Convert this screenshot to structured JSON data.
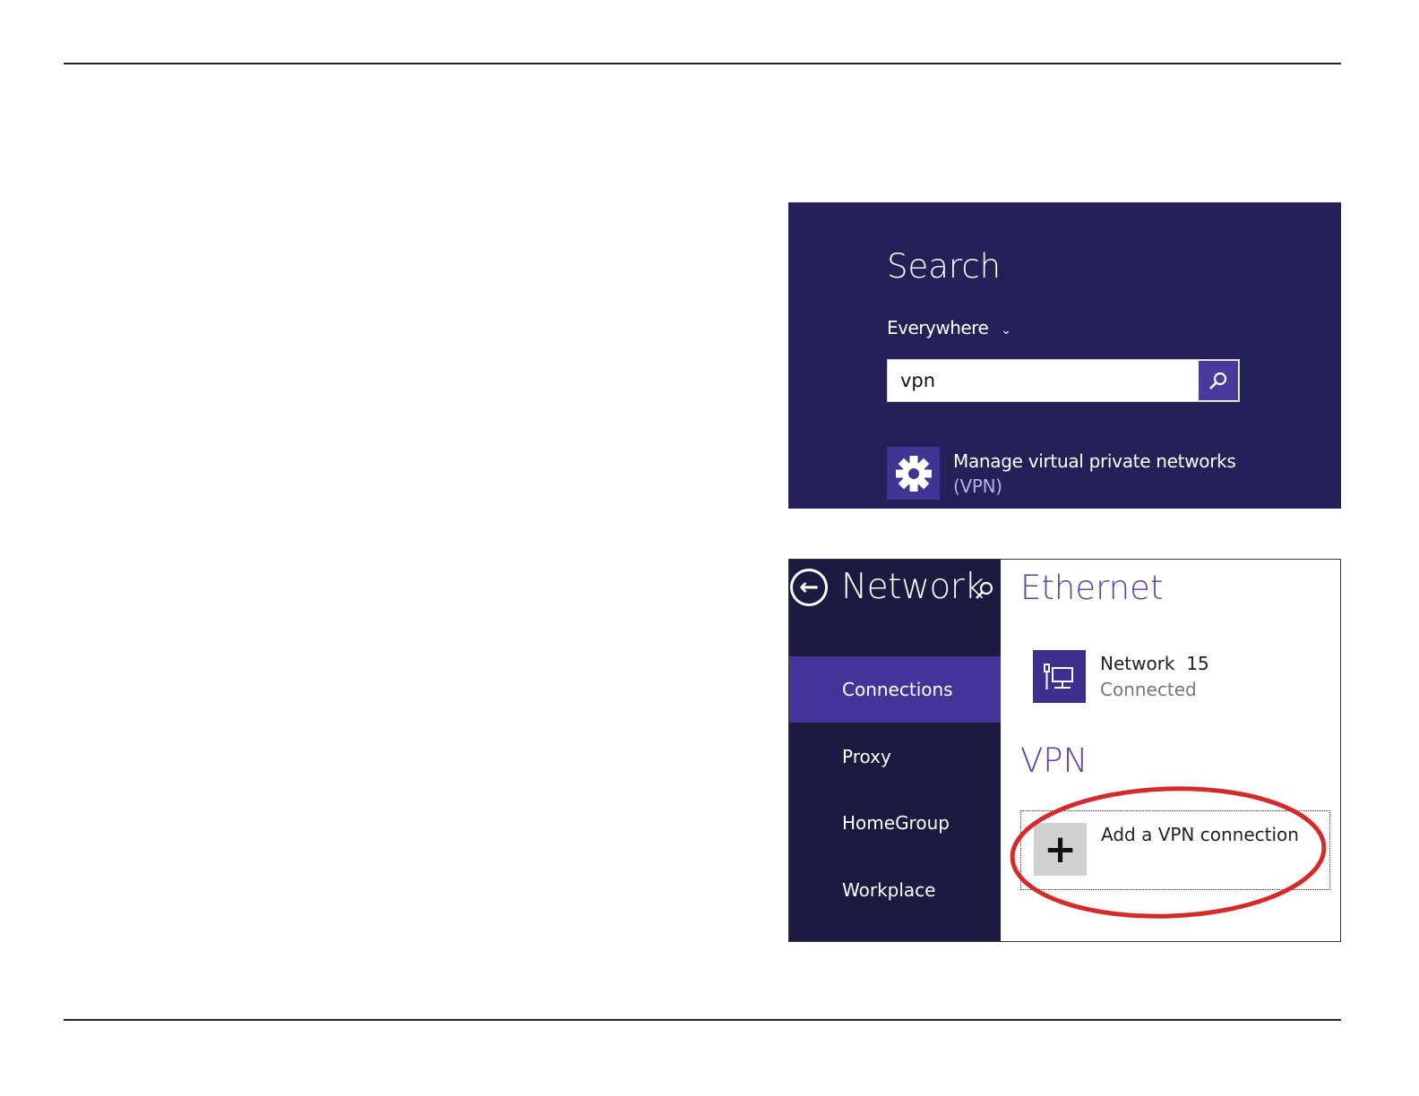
{
  "search_charm": {
    "title": "Search",
    "scope": "Everywhere",
    "query": "vpn",
    "search_icon": "magnifier-icon",
    "result": {
      "icon": "gear-icon",
      "label": "Manage virtual private networks",
      "label_suffix": "(VPN)"
    },
    "background": "#232157"
  },
  "network_settings": {
    "title": "Network",
    "nav": [
      {
        "label": "Connections",
        "active": true
      },
      {
        "label": "Proxy"
      },
      {
        "label": "HomeGroup"
      },
      {
        "label": "Workplace"
      }
    ],
    "ethernet_heading": "Ethernet",
    "connection": {
      "name": "Network  15",
      "status": "Connected",
      "icon": "wired-network-icon"
    },
    "vpn_heading": "VPN",
    "add_vpn_label": "Add a VPN connection",
    "highlight_color": "#d42a2a",
    "accent": "#45339a"
  }
}
